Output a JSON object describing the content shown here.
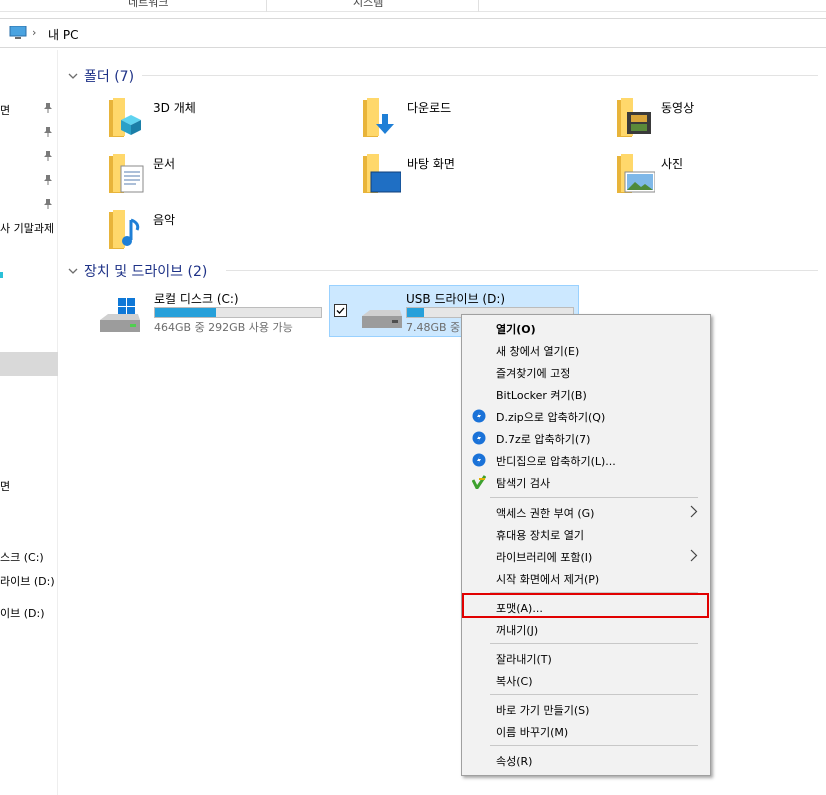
{
  "ribbon": {
    "group1": "네트워크",
    "group2": "시스템"
  },
  "address": {
    "crumb": "내 PC"
  },
  "nav": {
    "items": [
      "면",
      "",
      "",
      "",
      "",
      "사 기말과제",
      "",
      "",
      "면",
      "스크 (C:)",
      "라이브 (D:)",
      "이브 (D:)"
    ]
  },
  "folders_section": {
    "title": "폴더 (7)"
  },
  "folders": [
    {
      "label": "3D 개체",
      "icon": "3d-objects-folder-icon"
    },
    {
      "label": "다운로드",
      "icon": "downloads-folder-icon"
    },
    {
      "label": "동영상",
      "icon": "videos-folder-icon"
    },
    {
      "label": "문서",
      "icon": "documents-folder-icon"
    },
    {
      "label": "바탕 화면",
      "icon": "desktop-folder-icon"
    },
    {
      "label": "사진",
      "icon": "pictures-folder-icon"
    },
    {
      "label": "음악",
      "icon": "music-folder-icon"
    }
  ],
  "drives_section": {
    "title": "장치 및 드라이브 (2)"
  },
  "drives": [
    {
      "name": "로컬 디스크 (C:)",
      "info": "464GB 중 292GB 사용 가능",
      "used_fraction": 0.37
    },
    {
      "name": "USB 드라이브 (D:)",
      "info": "7.48GB 중",
      "used_fraction": 0.1
    }
  ],
  "context_menu": {
    "items": [
      {
        "label": "열기(O)",
        "bold": true
      },
      {
        "label": "새 창에서 열기(E)"
      },
      {
        "label": "즐겨찾기에 고정"
      },
      {
        "label": "BitLocker 켜기(B)"
      },
      {
        "label": "D.zip으로 압축하기(Q)",
        "icon": "bandizip-icon"
      },
      {
        "label": "D.7z로 압축하기(7)",
        "icon": "bandizip-icon"
      },
      {
        "label": "반디집으로 압축하기(L)...",
        "icon": "bandizip-icon"
      },
      {
        "label": "탐색기 검사",
        "icon": "virus-scan-icon"
      },
      {
        "label": "액세스 권한 부여 (G)",
        "submenu": true
      },
      {
        "label": "휴대용 장치로 열기"
      },
      {
        "label": "라이브러리에 포함(I)",
        "submenu": true
      },
      {
        "label": "시작 화면에서 제거(P)"
      },
      {
        "label": "포맷(A)...",
        "highlighted": true
      },
      {
        "label": "꺼내기(J)"
      },
      {
        "label": "잘라내기(T)"
      },
      {
        "label": "복사(C)"
      },
      {
        "label": "바로 가기 만들기(S)"
      },
      {
        "label": "이름 바꾸기(M)"
      },
      {
        "label": "속성(R)"
      }
    ]
  },
  "colors": {
    "accent": "#26a0da",
    "section_title": "#1e3287",
    "selection": "#cce8ff",
    "highlight_border": "#e10000"
  }
}
